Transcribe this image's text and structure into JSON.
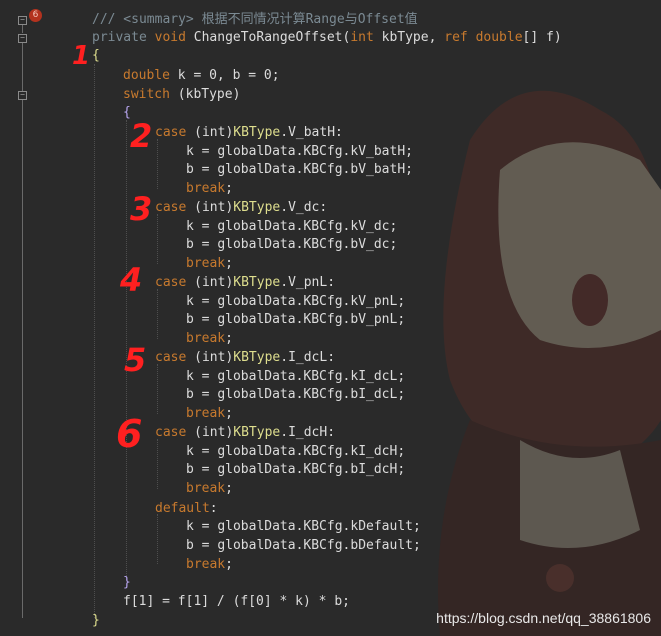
{
  "editor": {
    "breakpoint_badge": "6",
    "line_summary": "/// <summary> 根据不同情况计算Range与Offset值",
    "sig_private": "private",
    "sig_void": "void",
    "sig_name": " ChangeToRangeOffset(",
    "sig_int": "int",
    "sig_param1": " kbType, ",
    "sig_ref": "ref",
    "sig_double": "double",
    "sig_param2": "[] f)",
    "open_brace": "{",
    "decl_type": "double",
    "decl_rest": " k = 0, b = 0;",
    "switch_kw": "switch",
    "switch_rest": " (kbType)",
    "switch_open": "{",
    "cases": [
      {
        "member": "V_batH",
        "k_field": "kV_batH",
        "b_field": "bV_batH"
      },
      {
        "member": "V_dc",
        "k_field": "kV_dc",
        "b_field": "bV_dc"
      },
      {
        "member": "V_pnL",
        "k_field": "kV_pnL",
        "b_field": "bV_pnL"
      },
      {
        "member": "I_dcL",
        "k_field": "kI_dcL",
        "b_field": "bI_dcL"
      },
      {
        "member": "I_dcH",
        "k_field": "kI_dcH",
        "b_field": "bI_dcH"
      }
    ],
    "case_kw": "case",
    "case_int": "(int)",
    "enum_type": "KBType",
    "break_kw": "break",
    "default_kw": "default",
    "k_default": "kDefault",
    "b_default": "bDefault",
    "assign_prefix": "globalData.KBCfg.",
    "switch_close": "}",
    "final_line": "f[1] = f[1] / (f[0] * k) * b;",
    "close_brace": "}"
  },
  "annotations": [
    "1",
    "2",
    "3",
    "4",
    "5",
    "6"
  ],
  "watermark": "https://blog.csdn.net/qq_38861806",
  "colors": {
    "background": "#2a2a2a",
    "keyword": "#c87a2e",
    "type": "#dede8e",
    "comment": "#7b8a93",
    "annotation": "#ff2020"
  }
}
